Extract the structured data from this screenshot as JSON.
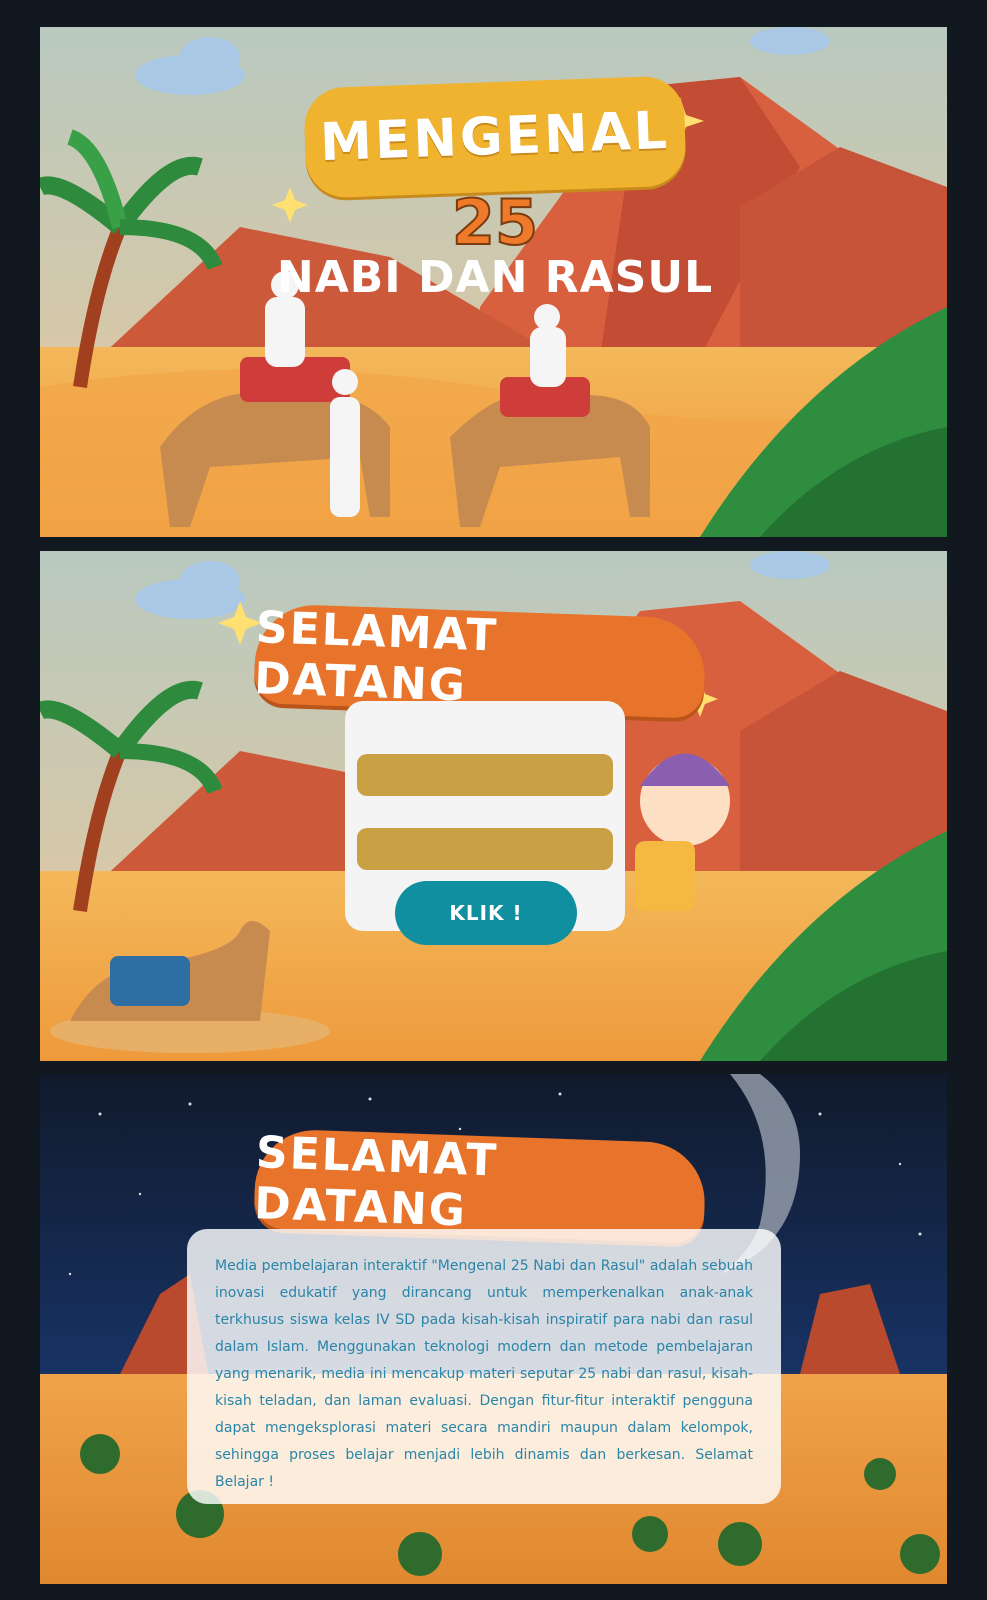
{
  "title_screen": {
    "title_top": "MENGENAL",
    "title_number": "25",
    "title_bottom": "NABI DAN RASUL"
  },
  "login_screen": {
    "banner": "SELAMAT DATANG",
    "button_label": "KLIK !"
  },
  "welcome_screen": {
    "banner": "SELAMAT DATANG",
    "description": "Media pembelajaran interaktif \"Mengenal 25 Nabi dan Rasul\" adalah sebuah inovasi edukatif yang dirancang untuk memperkenalkan anak-anak terkhusus siswa kelas IV SD pada kisah-kisah inspiratif para nabi dan rasul dalam Islam. Menggunakan teknologi modern dan metode pembelajaran yang menarik, media ini mencakup materi seputar 25 nabi dan rasul, kisah-kisah teladan, dan laman evaluasi. Dengan fitur-fitur interaktif pengguna dapat mengeksplorasi materi secara mandiri maupun dalam kelompok, sehingga proses belajar menjadi lebih dinamis dan berkesan. Selamat Belajar !"
  },
  "colors": {
    "sky": "#c9d2b8",
    "mountain": "#d9603f",
    "sand": "#f0a84a",
    "title_yellow": "#efb330",
    "banner_orange": "#e8732a",
    "field_gold": "#c9a043",
    "button_teal": "#0f8fa0",
    "night_sky": "#13233f",
    "desc_text": "#2a85a8"
  },
  "icons": [
    "cloud-icon",
    "palm-tree-icon",
    "fern-icon",
    "camel-icon",
    "sparkle-icon",
    "moon-icon",
    "boy-character-icon"
  ]
}
